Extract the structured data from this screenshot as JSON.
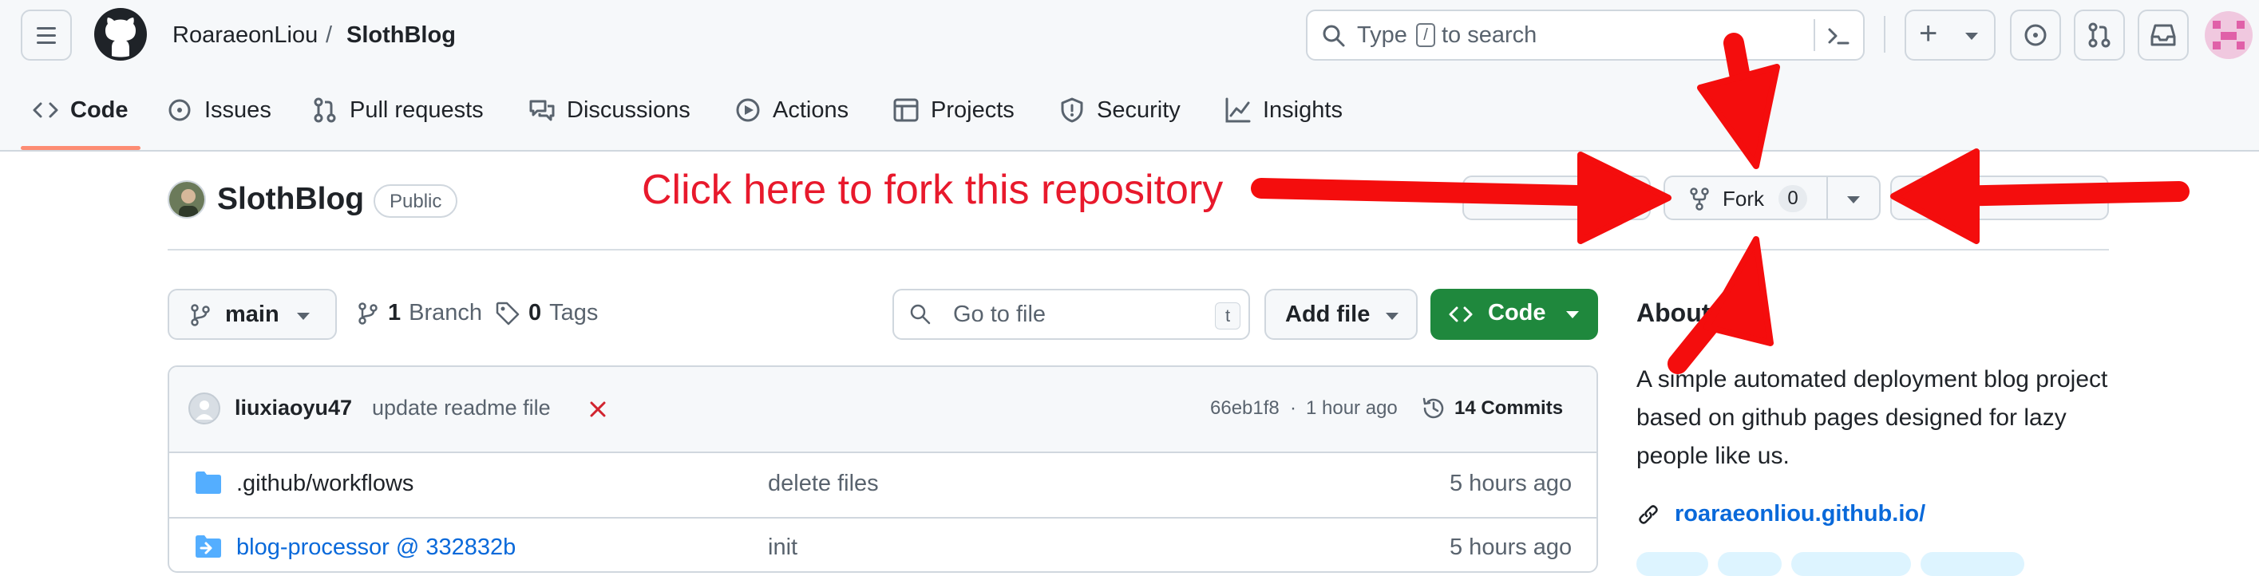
{
  "header": {
    "owner": "RoaraeonLiou",
    "separator": "/",
    "repo": "SlothBlog",
    "search_prefix": "Type",
    "search_key": "/",
    "search_suffix": "to search",
    "plus_symbol": "+"
  },
  "tabs": [
    {
      "label": "Code",
      "icon": "code-icon",
      "active": true
    },
    {
      "label": "Issues",
      "icon": "issue-icon"
    },
    {
      "label": "Pull requests",
      "icon": "pull-request-icon"
    },
    {
      "label": "Discussions",
      "icon": "discussion-icon"
    },
    {
      "label": "Actions",
      "icon": "play-icon"
    },
    {
      "label": "Projects",
      "icon": "table-icon"
    },
    {
      "label": "Security",
      "icon": "shield-icon"
    },
    {
      "label": "Insights",
      "icon": "graph-icon"
    }
  ],
  "repo": {
    "title": "SlothBlog",
    "visibility": "Public",
    "fork_label": "Fork",
    "fork_count": "0"
  },
  "annotation": {
    "text": "Click here to fork this repository",
    "color": "#e8192c"
  },
  "toolbar": {
    "branch": "main",
    "branch_count": "1",
    "branch_label": "Branch",
    "tag_count": "0",
    "tag_label": "Tags",
    "goto_placeholder": "Go to file",
    "goto_key": "t",
    "add_file": "Add file",
    "code_button": "Code"
  },
  "commit": {
    "author": "liuxiaoyu47",
    "message": "update readme file",
    "hash": "66eb1f8",
    "sep": "·",
    "time": "1 hour ago",
    "commits_label": "14 Commits"
  },
  "files": [
    {
      "name": ".github/workflows",
      "message": "delete files",
      "time": "5 hours ago",
      "icon": "folder-icon"
    },
    {
      "name": "blog-processor @ 332832b",
      "message": "init",
      "time": "5 hours ago",
      "icon": "submodule-icon"
    }
  ],
  "about": {
    "title": "About",
    "description": "A simple automated deployment blog project based on github pages designed for lazy people like us.",
    "link": "roaraeonliou.github.io/"
  },
  "colors": {
    "accent_green": "#1f883d",
    "link_blue": "#0969da",
    "active_tab_underline": "#fd8c73",
    "annotation_red": "#e8192c"
  }
}
